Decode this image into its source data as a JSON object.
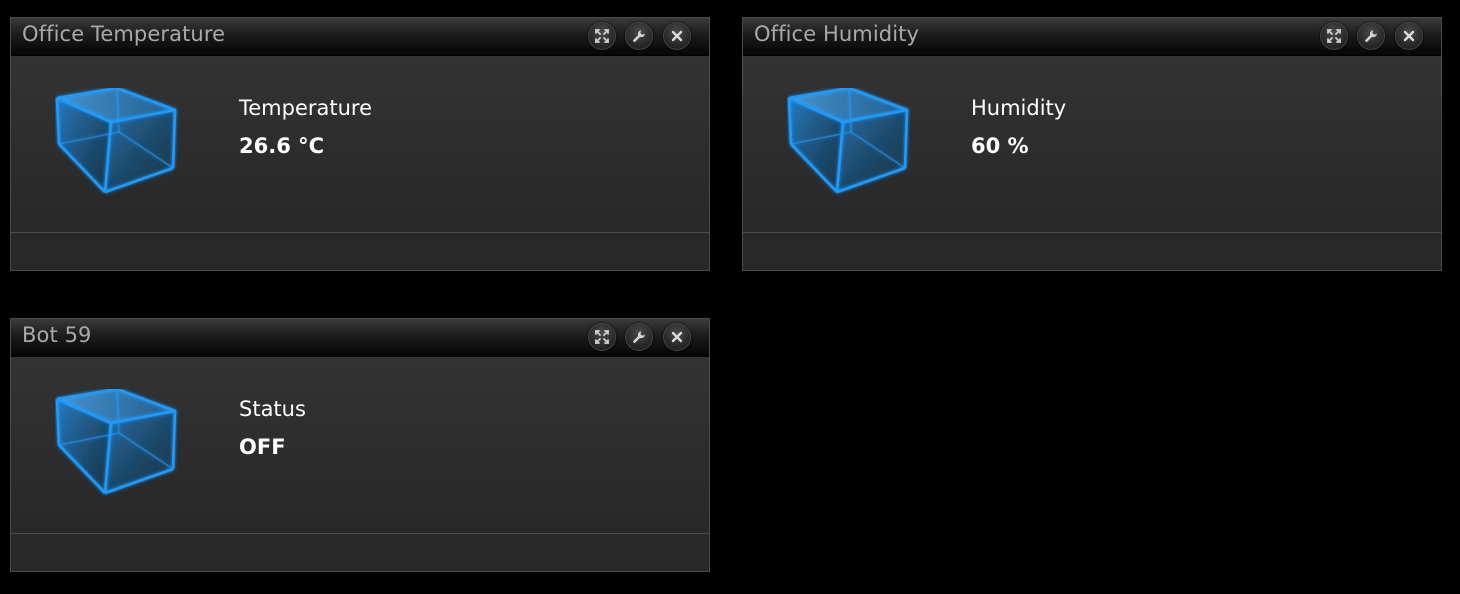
{
  "colors": {
    "accent": "#1e9bff",
    "background": "#000000",
    "panel": "#2e2e2e",
    "title_text": "#a9a9a9",
    "value_text": "#ffffff"
  },
  "widgets": [
    {
      "title": "Office Temperature",
      "icon": "cube-icon",
      "label": "Temperature",
      "value": "26.6 °C"
    },
    {
      "title": "Office Humidity",
      "icon": "cube-icon",
      "label": "Humidity",
      "value": "60 %"
    },
    {
      "title": "Bot 59",
      "icon": "cube-icon",
      "label": "Status",
      "value": "OFF"
    }
  ],
  "window_buttons": {
    "expand_icon": "expand-icon",
    "settings_icon": "wrench-icon",
    "close_icon": "close-icon"
  }
}
